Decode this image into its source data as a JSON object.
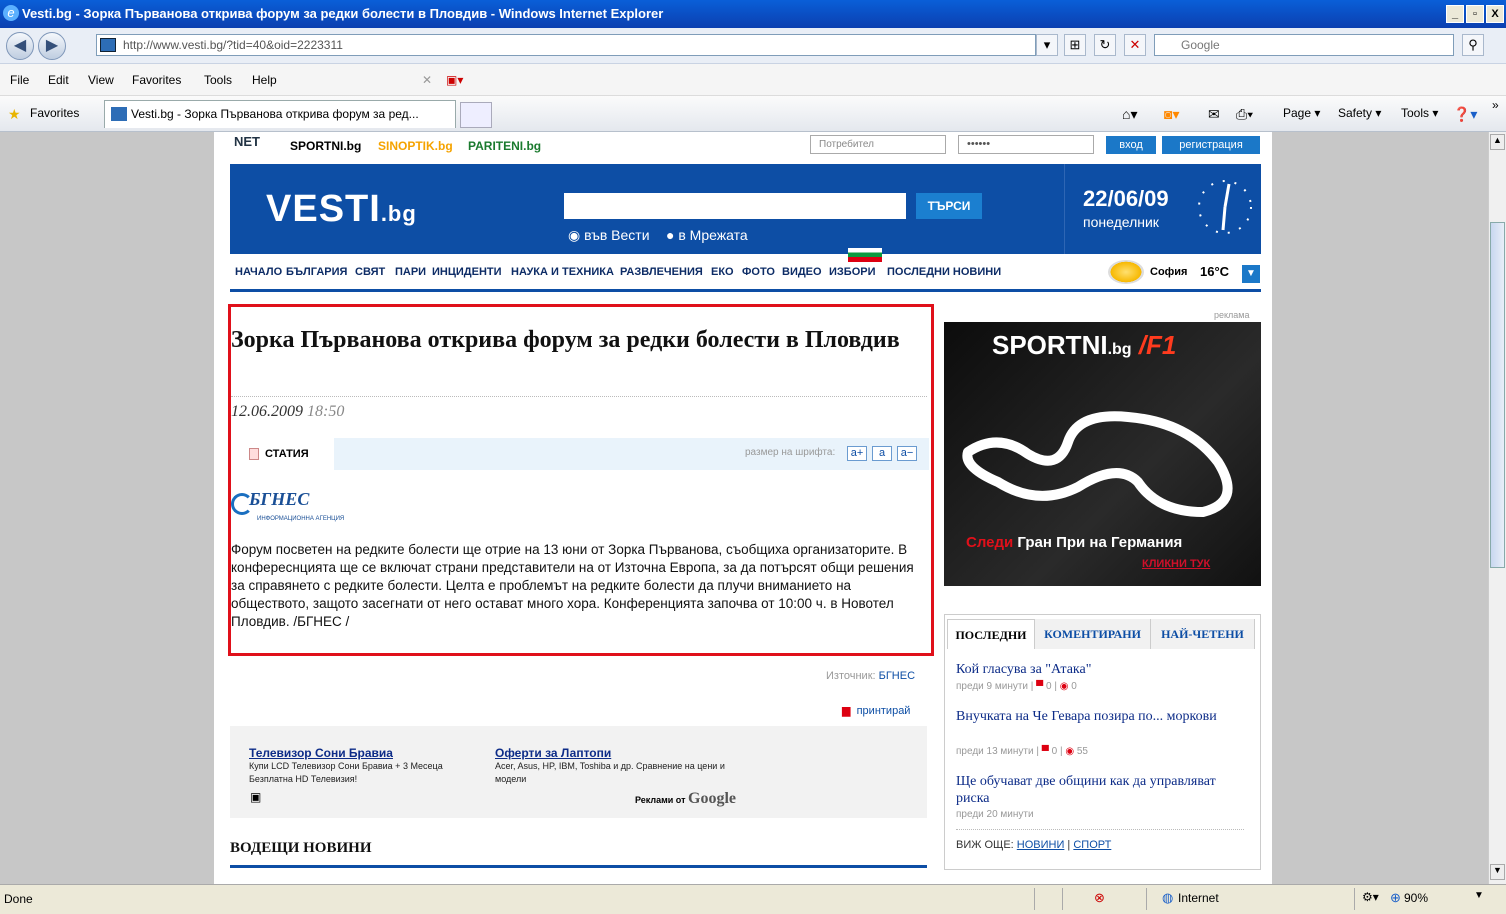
{
  "window": {
    "title": "Vesti.bg - Зорка Първанова открива форум за редки болести в Пловдив - Windows Internet Explorer",
    "controls": [
      "_",
      "▫",
      "X"
    ]
  },
  "address_bar": {
    "url": "http://www.vesti.bg/?tid=40&oid=2223311",
    "search_placeholder": "Google"
  },
  "menu": [
    "File",
    "Edit",
    "View",
    "Favorites",
    "Tools",
    "Help"
  ],
  "favorites_bar": {
    "favorites_label": "Favorites",
    "tab_title": "Vesti.bg - Зорка Първанова открива форум за ред...",
    "commands": [
      "Page ▾",
      "Safety ▾",
      "Tools ▾"
    ]
  },
  "site": {
    "top_links": [
      "SPORTNI.bg",
      "SINOPTIK.bg",
      "PARITENI.bg"
    ],
    "login_user_placeholder": "Потребител",
    "login_password_value": "••••••",
    "login_button": "вход",
    "register_button": "регистрация",
    "brand": "VESTI",
    "brand_suffix": ".bg",
    "search_button": "ТЪРСИ",
    "search_options": [
      "във Вести",
      "в Мрежата"
    ],
    "date": "22/06/09",
    "day": "понеделник",
    "nav": [
      "НАЧАЛО",
      "БЪЛГАРИЯ",
      "СВЯТ",
      "ПАРИ",
      "ИНЦИДЕНТИ",
      "НАУКА И ТЕХНИКА",
      "РАЗВЛЕЧЕНИЯ",
      "ЕКО",
      "ФОТО",
      "ВИДЕО",
      "ИЗБОРИ",
      "ПОСЛЕДНИ НОВИНИ"
    ],
    "weather_city": "София",
    "weather_temp": "16°C"
  },
  "article": {
    "title": "Зорка Първанова открива форум за редки болести в Пловдив",
    "date": "12.06.2009",
    "time": "18:50",
    "tab_label": "СТАТИЯ",
    "font_size_label": "размер на шрифта:",
    "font_buttons": [
      "а+",
      "а",
      "а−"
    ],
    "agency_logo": "БГНЕС",
    "agency_sub": "ИНФОРМАЦИОННА АГЕНЦИЯ",
    "body": "Форум посветен на редките болести ще отрие на 13 юни от Зорка Първанова, съобщиха организаторите. В конферecнцията ще се включат страни представители на от Източна Европа, за да потърсят общи решения за справянето с редките болести. Целта е проблемът на редките болести да плучи вниманието на обществото, защото засегнати от него остават много хора. Конференцията започва от 10:00 ч. в Новотел Пловдив. /БГНЕС /",
    "source_label": "Източник:",
    "source": "БГНЕС",
    "print": "принтирай"
  },
  "ads": [
    {
      "title": "Телевизор Сони Бравиа",
      "text": "Купи LCD Телевизор Сони Бравиа + 3 Месеца Безплатна HD Телевизия!"
    },
    {
      "title": "Оферти за Лаптопи",
      "text": "Acer, Asus, HP, IBM, Toshiba и др. Сравнение на цени и модели"
    }
  ],
  "ads_by": "Реклами от",
  "ads_google": "Google",
  "leading_news": "ВОДЕЩИ НОВИНИ",
  "sidebar": {
    "ad_label": "реклама",
    "banner_logo": "SPORTNI",
    "banner_logo_suffix": ".bg",
    "banner_f1": "/F1",
    "banner_text_red": "Следи",
    "banner_text": " Гран При на Германия",
    "banner_click": "КЛИКНИ ТУК",
    "tabs": [
      "ПОСЛЕДНИ",
      "КОМЕНТИРАНИ",
      "НАЙ-ЧЕТЕНИ"
    ],
    "news": [
      {
        "title": "Кой гласува за \"Атака\"",
        "meta": "преди 9 минути |",
        "comments": "0",
        "views": "0"
      },
      {
        "title": "Внучката на Че Гевара позира по... моркови",
        "meta": "преди 13 минути |",
        "comments": "0",
        "views": "55"
      },
      {
        "title": "Ще обучават две общини как да управляват риска",
        "meta": "преди 20 минути"
      }
    ],
    "more_label": "ВИЖ ОЩЕ:",
    "more_links": [
      "НОВИНИ",
      "СПОРТ"
    ]
  },
  "status": {
    "left": "Done",
    "zone": "Internet",
    "zoom": "90%"
  }
}
